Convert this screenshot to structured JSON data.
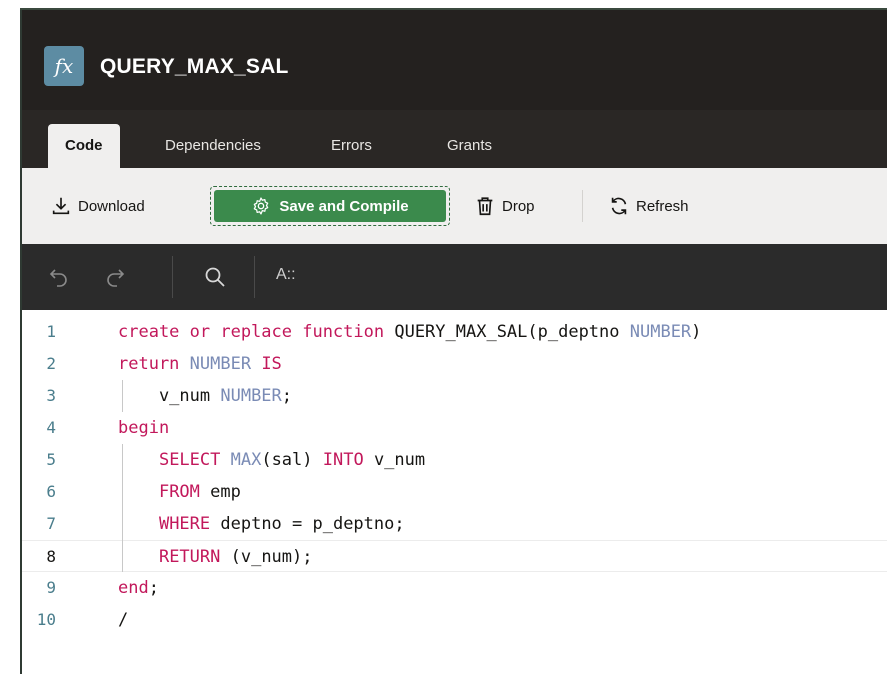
{
  "header": {
    "fx_glyph": "fx",
    "title": "QUERY_MAX_SAL"
  },
  "tabs": [
    {
      "label": "Code",
      "active": true
    },
    {
      "label": "Dependencies",
      "active": false
    },
    {
      "label": "Errors",
      "active": false
    },
    {
      "label": "Grants",
      "active": false
    }
  ],
  "toolbar": {
    "download_label": "Download",
    "save_label": "Save and Compile",
    "drop_label": "Drop",
    "refresh_label": "Refresh"
  },
  "editor_toolbar": {
    "font_label": "A::"
  },
  "code": {
    "active_line": 8,
    "lines": [
      {
        "n": "1",
        "tokens": [
          [
            "kw",
            "create or replace function "
          ],
          [
            "tx",
            "QUERY_MAX_SAL(p_deptno "
          ],
          [
            "ty",
            "NUMBER"
          ],
          [
            "tx",
            ")"
          ]
        ]
      },
      {
        "n": "2",
        "tokens": [
          [
            "kw",
            "return "
          ],
          [
            "ty",
            "NUMBER "
          ],
          [
            "kw",
            "IS"
          ]
        ]
      },
      {
        "n": "3",
        "tokens": [
          [
            "tx",
            "    v_num "
          ],
          [
            "ty",
            "NUMBER"
          ],
          [
            "tx",
            ";"
          ]
        ]
      },
      {
        "n": "4",
        "tokens": [
          [
            "kw",
            "begin"
          ]
        ]
      },
      {
        "n": "5",
        "tokens": [
          [
            "tx",
            "    "
          ],
          [
            "kw",
            "SELECT "
          ],
          [
            "ty",
            "MAX"
          ],
          [
            "tx",
            "(sal) "
          ],
          [
            "kw",
            "INTO "
          ],
          [
            "tx",
            "v_num"
          ]
        ]
      },
      {
        "n": "6",
        "tokens": [
          [
            "tx",
            "    "
          ],
          [
            "kw",
            "FROM "
          ],
          [
            "tx",
            "emp"
          ]
        ]
      },
      {
        "n": "7",
        "tokens": [
          [
            "tx",
            "    "
          ],
          [
            "kw",
            "WHERE "
          ],
          [
            "tx",
            "deptno = p_deptno;"
          ]
        ]
      },
      {
        "n": "8",
        "tokens": [
          [
            "tx",
            "    "
          ],
          [
            "kw",
            "RETURN "
          ],
          [
            "tx",
            "(v_num);"
          ]
        ]
      },
      {
        "n": "9",
        "tokens": [
          [
            "kw",
            "end"
          ],
          [
            "tx",
            ";"
          ]
        ]
      },
      {
        "n": "10",
        "tokens": [
          [
            "tx",
            "/"
          ]
        ]
      }
    ]
  },
  "colors": {
    "header_bg": "#24211f",
    "save_button": "#3b8a4c",
    "keyword": "#c2185b",
    "type": "#7a8bb5",
    "line_number": "#4a7d8c"
  }
}
